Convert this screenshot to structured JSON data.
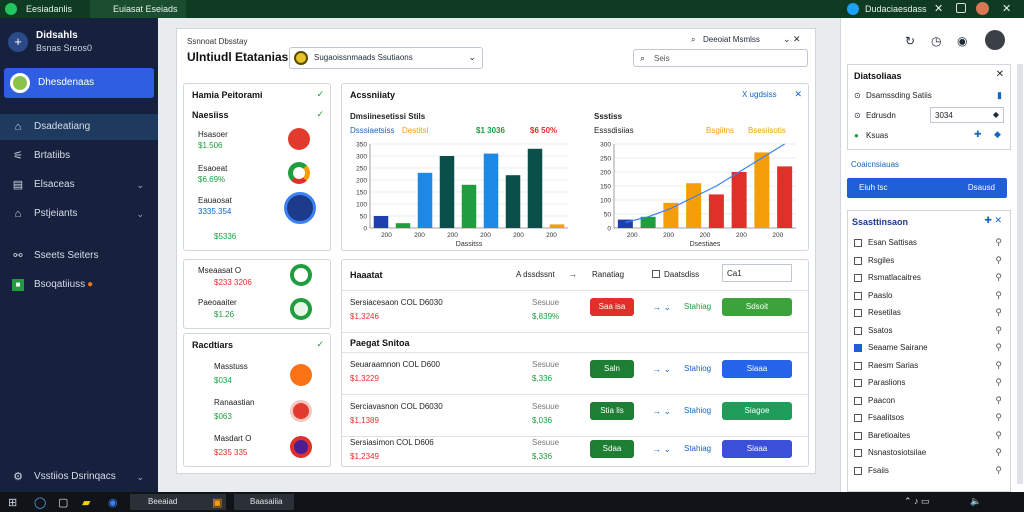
{
  "browser": {
    "tabs": [
      {
        "label": "Eesiadanlis"
      },
      {
        "label": "Euiasat Eseiads"
      }
    ],
    "profile_label": "Dudaciaesdass"
  },
  "sidebar": {
    "brand_title": "Didsahls",
    "brand_subtitle": "Bsnas Sreos0",
    "active_item": "Dhesdenaas",
    "items": [
      {
        "label": "Dsadeatiang",
        "icon": "home-icon"
      },
      {
        "label": "Brtatiibs",
        "icon": "chart-icon"
      },
      {
        "label": "Elsaceas",
        "icon": "list-icon"
      },
      {
        "label": "Pstjeiants",
        "icon": "folder-icon"
      },
      {
        "label": "Sseets Seiters",
        "icon": "link-icon"
      },
      {
        "label": "Bsoqatiiuss",
        "icon": "grid-icon"
      }
    ],
    "footer": "Vsstiios Dsrinqacs"
  },
  "header": {
    "kicker": "Ssnnoat Dbsstay",
    "title": "Ulntiudl Etatanias",
    "filter_value": "Sugaoissnmaads Ssutiaons",
    "nav_label": "Deeoiat Msmlss",
    "search_placeholder": "Seis"
  },
  "summary_card": {
    "title": "Hamia Peitorami",
    "subtitle": "Naesiiss",
    "items": [
      {
        "label": "Hsasoer",
        "value": "$1.506",
        "value_color": "#1e9e3e"
      },
      {
        "label": "Esaoeat",
        "value": "$6.69%",
        "value_color": "#1e9e3e"
      },
      {
        "label": "Eauaosat",
        "value": "3335.354",
        "value_color": "#1565c0"
      },
      {
        "label": "",
        "value": "$5336",
        "value_color": "#1e9e3e"
      }
    ]
  },
  "chart1": {
    "title": "Acssniiaty",
    "subtitle": "Dmsiinesetissi Stils",
    "legend": [
      {
        "name": "Dsssiaetsiss",
        "color": "#1565c0"
      },
      {
        "name": "Destitsl",
        "color": "#f59e0b"
      }
    ],
    "badges": [
      {
        "text": "$1 3036",
        "color": "#1e9e3e"
      },
      {
        "text": "$6 50%",
        "color": "#e0302a"
      }
    ],
    "xlabel": "Dassitss",
    "x_menu": "X ugdsiss"
  },
  "chart2": {
    "title": "Ssstiss",
    "subtitle": "Esssdisiias",
    "legend": [
      {
        "name": "Bsgiitns",
        "color": "#f59e0b"
      },
      {
        "name": "Bsesiisotis",
        "color": "#f59e0b"
      }
    ],
    "xlabel": "Dsestiaes"
  },
  "chart_data": [
    {
      "type": "bar",
      "categories": [
        "20a",
        "20b",
        "20c",
        "20d",
        "20e",
        "20f",
        "20g",
        "20h",
        "20i"
      ],
      "ytick_labels": [
        "0",
        "50",
        "100",
        "150",
        "200",
        "250",
        "300",
        "350"
      ],
      "xtick_labels": [
        "200",
        "200",
        "200",
        "200",
        "200",
        "200"
      ],
      "ylim": [
        0,
        350
      ],
      "values": [
        50,
        20,
        230,
        300,
        180,
        310,
        220,
        330,
        15
      ],
      "colors": [
        "#1e40af",
        "#1e9e3e",
        "#1e88e5",
        "#0b4f4a",
        "#1e9e3e",
        "#1e88e5",
        "#0b4f4a",
        "#0b4f4a",
        "#f59e0b"
      ]
    },
    {
      "type": "bar",
      "categories": [
        "a",
        "b",
        "c",
        "d",
        "e",
        "f",
        "g",
        "h"
      ],
      "ytick_labels": [
        "0",
        "50",
        "100",
        "150",
        "200",
        "250",
        "300"
      ],
      "xtick_labels": [
        "200",
        "200",
        "200",
        "200",
        "200"
      ],
      "ylim": [
        0,
        300
      ],
      "values": [
        30,
        40,
        90,
        160,
        120,
        200,
        270,
        220
      ],
      "colors": [
        "#1e40af",
        "#1e9e3e",
        "#f59e0b",
        "#f59e0b",
        "#e0302a",
        "#e0302a",
        "#f59e0b",
        "#e0302a"
      ],
      "trend": [
        20,
        40,
        70,
        110,
        150,
        200,
        250,
        300
      ]
    }
  ],
  "mid_card": {
    "items": [
      {
        "label": "Mseaasat O",
        "value": "$233 3206",
        "value_color": "#e0302a"
      },
      {
        "label": "Paeoaaiter",
        "value": "$1.26",
        "value_color": "#1e9e3e"
      }
    ]
  },
  "bottom_left_card": {
    "title": "Racdtiars",
    "items": [
      {
        "label": "Masstuss",
        "value": "$034",
        "value_color": "#1e9e3e"
      },
      {
        "label": "Ranaastian",
        "value": "$063",
        "value_color": "#1e9e3e"
      },
      {
        "label": "Masdart O",
        "value": "$235 335",
        "value_color": "#e0302a"
      }
    ]
  },
  "table": {
    "header_title": "Haaatat",
    "header_cols": [
      "A dssdssnt",
      "Ranatiag",
      "Daatsdiss"
    ],
    "header_input": "Ca1",
    "section_title": "Paegat Snitoa",
    "rows": [
      {
        "name": "Sersiacesaon COL D6030",
        "amount": "$1,3246",
        "pct": "$,839%",
        "pct_pre": "Sesuue",
        "btn": "Saa isa",
        "btn_color": "#e0302a",
        "status": "Stahiag",
        "bar": "Sdsoit",
        "bar_color": "#3ca33b"
      },
      {
        "name": "Seuaraamnon COL D600",
        "amount": "$1,3229",
        "pct": "$,336",
        "pct_pre": "Sesuue",
        "btn": "Saln",
        "btn_color": "#1e7e34",
        "status": "Stahiog",
        "bar": "Siaaa",
        "bar_color": "#2563eb"
      },
      {
        "name": "Serciavasnon COL D6030",
        "amount": "$1,1389",
        "pct": "$,036",
        "pct_pre": "Sesuue",
        "btn": "Stia lis",
        "btn_color": "#1e7e34",
        "status": "Stahiog",
        "bar": "Siagoe",
        "bar_color": "#1e9e5a"
      },
      {
        "name": "Sersiasimon COL D606",
        "amount": "$1,2349",
        "pct": "$,336",
        "pct_pre": "Sesuue",
        "btn": "Sdaa",
        "btn_color": "#1e7e34",
        "status": "Stahiag",
        "bar": "Siaaa",
        "bar_color": "#3b4fd8"
      }
    ]
  },
  "right_panel": {
    "card1": {
      "title": "Diatsoliaas",
      "rows": [
        {
          "label": "Dsamssding Satiis"
        },
        {
          "label": "Edrusdn",
          "input": "3034"
        },
        {
          "label": "Ksuas"
        }
      ]
    },
    "section_label": "Coaicnsiauas",
    "btn_left": "Eiuh tsc",
    "btn_right": "Dsausd",
    "list_title": "Ssasttinsaon",
    "list": [
      {
        "label": "Esan Sattisas",
        "checked": false
      },
      {
        "label": "Rsgiles",
        "checked": false
      },
      {
        "label": "Rsmatlacaitres",
        "checked": false
      },
      {
        "label": "Paaslo",
        "checked": false
      },
      {
        "label": "Resetilas",
        "checked": false
      },
      {
        "label": "Ssatos",
        "checked": false
      },
      {
        "label": "Seaame Sairane",
        "checked": true
      },
      {
        "label": "Raesm Sarias",
        "checked": false
      },
      {
        "label": "Paraslions",
        "checked": false
      },
      {
        "label": "Paacon",
        "checked": false
      },
      {
        "label": "Fsaalitsos",
        "checked": false
      },
      {
        "label": "Baretioaites",
        "checked": false
      },
      {
        "label": "Nsnastosiotsilae",
        "checked": false
      },
      {
        "label": "Fsaiis",
        "checked": false
      }
    ]
  },
  "taskbar": {
    "items": [
      {
        "label": "Beeaiad"
      },
      {
        "label": "Baasaiiia"
      }
    ]
  }
}
